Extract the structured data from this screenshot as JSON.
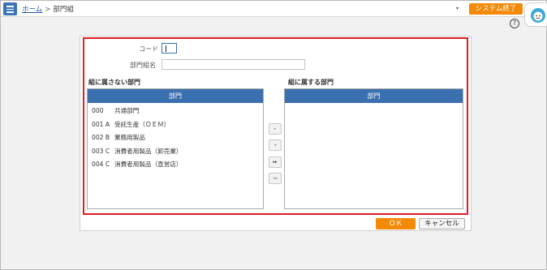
{
  "header": {
    "breadcrumb_home": "ホーム",
    "breadcrumb_separator": ">",
    "breadcrumb_current": "部門組",
    "dropdown_caret": "▾",
    "exit_label": "システム終了",
    "help_label": "?"
  },
  "form": {
    "code_label": "コード",
    "code_value": "",
    "name_label": "部門組名",
    "name_value": ""
  },
  "left_list": {
    "title": "組に属さない部門",
    "column_header": "部門",
    "rows": [
      {
        "code": "000",
        "name": "共通部門"
      },
      {
        "code": "001 A",
        "name": "受託生産（ＯＥＭ）"
      },
      {
        "code": "002 B",
        "name": "業務用製品"
      },
      {
        "code": "003 C",
        "name": "消費者用製品（卸売業）"
      },
      {
        "code": "004 C",
        "name": "消費者用製品（直営店）"
      }
    ]
  },
  "right_list": {
    "title": "組に属する部門",
    "column_header": "部門",
    "rows": []
  },
  "move_buttons": {
    "add_one": "▸",
    "remove_one": "◂",
    "add_all": "▸▸",
    "remove_all": "◂◂"
  },
  "footer": {
    "ok_label": "ＯＫ",
    "cancel_label": "キャンセル"
  },
  "colors": {
    "accent_orange": "#f28a06",
    "header_blue": "#3a6fb0",
    "highlight_red": "#e01b22"
  }
}
